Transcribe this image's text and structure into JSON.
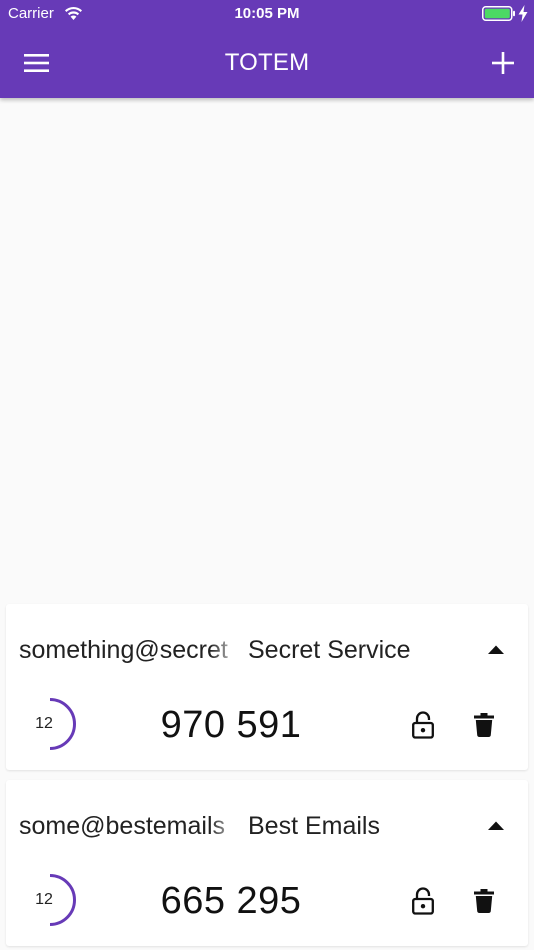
{
  "status_bar": {
    "carrier": "Carrier",
    "time": "10:05 PM",
    "icons": [
      "wifi-icon",
      "battery-icon",
      "charging-bolt-icon"
    ]
  },
  "app_bar": {
    "title": "TOTEM",
    "menu_icon": "hamburger-menu-icon",
    "add_icon": "plus-icon",
    "color": "#673ab7"
  },
  "accounts": [
    {
      "user": "something@secret",
      "issuer": "Secret Service",
      "timer": "12",
      "timer_fraction": 0.4,
      "code": "970 591",
      "icons": [
        "expand-up-icon",
        "unlocked-padlock-icon",
        "trash-icon"
      ]
    },
    {
      "user": "some@bestemails",
      "issuer": "Best Emails",
      "timer": "12",
      "timer_fraction": 0.4,
      "code": "665 295",
      "icons": [
        "expand-up-icon",
        "unlocked-padlock-icon",
        "trash-icon"
      ]
    }
  ],
  "colors": {
    "accent": "#673ab7",
    "background": "#fafafa",
    "card": "#ffffff",
    "text": "#222222"
  }
}
